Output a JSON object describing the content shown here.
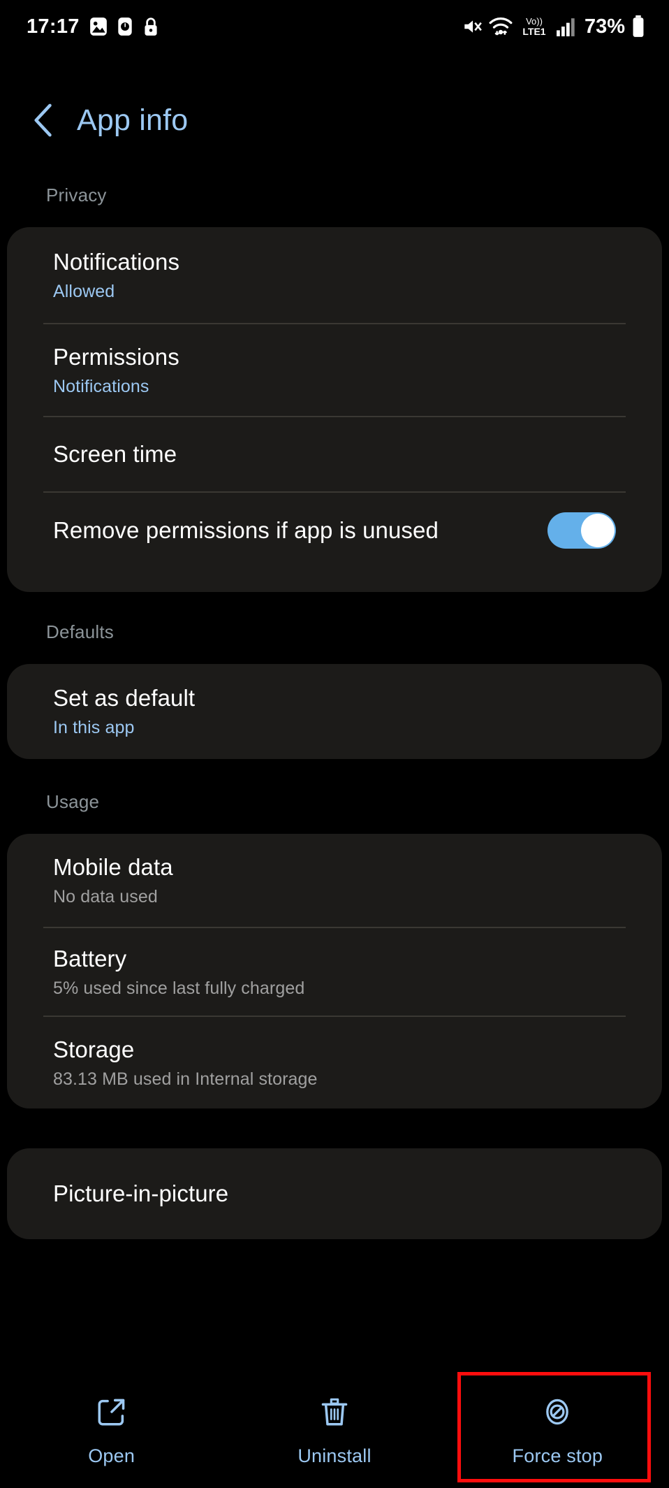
{
  "status_bar": {
    "time": "17:17",
    "left_icons": [
      "image-icon",
      "clock-icon",
      "lock-icon"
    ],
    "right_icons": [
      "mute-icon",
      "wifi-icon",
      "volte-icon",
      "signal-bars-icon",
      "battery-icon"
    ],
    "network_label_top": "Vo))",
    "network_label_bottom": "LTE1",
    "battery_percent": "73%"
  },
  "app_bar": {
    "back_label": "back-chevron",
    "title": "App info"
  },
  "sections": [
    {
      "label": "Privacy",
      "rows": [
        {
          "title": "Notifications",
          "sub": "Allowed",
          "sub_style": "blue",
          "control": "none"
        },
        {
          "title": "Permissions",
          "sub": "Notifications",
          "sub_style": "blue",
          "control": "none"
        },
        {
          "title": "Screen time",
          "sub": "",
          "sub_style": "none",
          "control": "none"
        },
        {
          "title": "Remove permissions if app is unused",
          "sub": "",
          "sub_style": "none",
          "control": "toggle",
          "toggle_on": true
        }
      ]
    },
    {
      "label": "Defaults",
      "rows": [
        {
          "title": "Set as default",
          "sub": "In this app",
          "sub_style": "blue",
          "control": "none"
        }
      ]
    },
    {
      "label": "Usage",
      "rows": [
        {
          "title": "Mobile data",
          "sub": "No data used",
          "sub_style": "grey",
          "control": "none"
        },
        {
          "title": "Battery",
          "sub": "5% used since last fully charged",
          "sub_style": "grey",
          "control": "none"
        },
        {
          "title": "Storage",
          "sub": "83.13 MB used in Internal storage",
          "sub_style": "grey",
          "control": "none"
        }
      ]
    },
    {
      "label": "",
      "rows": [
        {
          "title": "Picture-in-picture",
          "sub": "",
          "sub_style": "none",
          "control": "none"
        }
      ]
    }
  ],
  "bottom_bar": {
    "actions": [
      {
        "icon": "open-external-icon",
        "label": "Open",
        "highlighted": false
      },
      {
        "icon": "trash-icon",
        "label": "Uninstall",
        "highlighted": false
      },
      {
        "icon": "force-stop-icon",
        "label": "Force stop",
        "highlighted": true
      }
    ]
  },
  "colors": {
    "accent_blue": "#9CC8F2",
    "toggle_on": "#64B0EA",
    "card_bg": "#1C1B19",
    "page_bg": "#000000",
    "section_label": "#8C9499",
    "sub_grey": "#A0A0A0",
    "highlight_box": "#FF0D0D"
  }
}
